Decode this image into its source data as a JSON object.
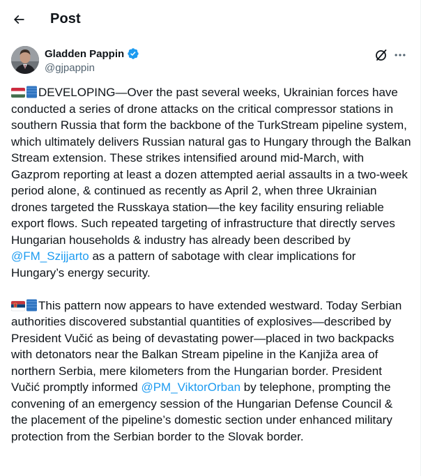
{
  "header": {
    "title": "Post"
  },
  "author": {
    "display_name": "Gladden Pappin",
    "handle": "@gjpappin"
  },
  "tweet": {
    "p1_before": "DEVELOPING—Over the past several weeks, Ukrainian forces have conducted a series of drone attacks on the critical compressor stations in southern Russia that form the backbone of the TurkStream pipeline system, which ultimately delivers Russian natural gas to Hungary through the Balkan Stream extension. These strikes intensified around mid-March, with Gazprom reporting at least a dozen attempted aerial assaults in a two-week period alone, & continued as recently as April 2, when three Ukrainian drones targeted the Russkaya station—the key facility ensuring reliable export flows. Such repeated targeting of infrastructure that directly serves Hungarian households & industry has already been described by ",
    "p1_mention": "@FM_Szijjarto",
    "p1_after": " as a pattern of sabotage with clear implications for Hungary’s energy security.",
    "p2_before": "This pattern now appears to have extended westward. Today Serbian authorities discovered substantial quantities of explosives—described by President Vučić as being of devastating power—placed in two backpacks with detonators near the Balkan Stream pipeline in the Kanjiža area of northern Serbia, mere kilometers from the Hungarian border. President Vučić promptly informed ",
    "p2_mention": "@PM_ViktorOrban",
    "p2_after": " by telephone, prompting the convening of an emergency session of the Hungarian Defense Council & the placement of the pipeline’s domestic section under enhanced military protection from the Serbian border to the Slovak border."
  },
  "icons": {
    "back": "arrow-left-icon",
    "verified": "verified-badge-icon",
    "grok": "grok-icon",
    "more": "more-horizontal-icon",
    "flag_hu": "hungary-flag-icon",
    "flag_rs": "serbia-flag-icon",
    "square": "blue-square-icon"
  },
  "colors": {
    "text": "#0f1419",
    "secondary": "#536471",
    "link": "#1d9bf0",
    "verified": "#1d9bf0"
  }
}
